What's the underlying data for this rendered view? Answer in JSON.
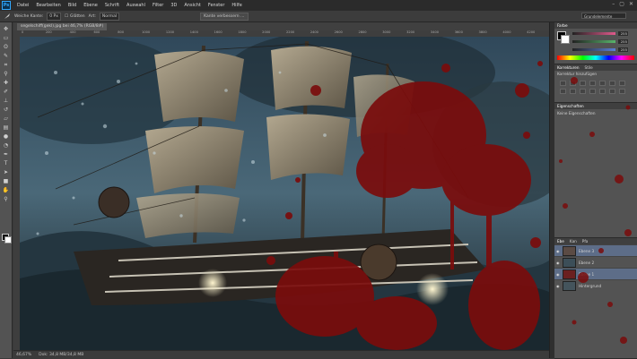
{
  "app": {
    "logo": "Ps",
    "menu": [
      "Datei",
      "Bearbeiten",
      "Bild",
      "Ebene",
      "Schrift",
      "Auswahl",
      "Filter",
      "3D",
      "Ansicht",
      "Fenster",
      "Hilfe"
    ],
    "window_controls": [
      "–",
      "▢",
      "✕"
    ]
  },
  "options_bar": {
    "tool_icon": "brush-icon",
    "size_label": "Weiche Kante:",
    "size_value": "0 Px",
    "smooth_label": "Glätten",
    "style_label": "Art:",
    "style_value": "Normal",
    "refine_button": "Kante verbessern …",
    "workspace": "Grundelemente"
  },
  "document": {
    "tab_title": "segelschiff(gekl).jpg bei 46,7% (RGB/8#)",
    "ruler_marks": [
      "0",
      "200",
      "400",
      "600",
      "800",
      "1000",
      "1200",
      "1400",
      "1600",
      "1800",
      "2000",
      "2200",
      "2400",
      "2600",
      "2800",
      "3000",
      "3200",
      "3400",
      "3600",
      "3800",
      "4000",
      "4200"
    ]
  },
  "status": {
    "zoom": "46,67%",
    "doc_size": "Dok: 34,8 MB/34,8 MB"
  },
  "panels": {
    "color": {
      "title": "Farbe",
      "sliders": [
        {
          "value": "255",
          "color": "#e05a8c"
        },
        {
          "value": "255",
          "color": "#58b36a"
        },
        {
          "value": "255",
          "color": "#5a7fd6"
        }
      ]
    },
    "adjustments": {
      "tabs": [
        "Korrekturen",
        "Stile"
      ],
      "title": "Korrektur hinzufügen"
    },
    "properties": {
      "tabs": [
        "Eigenschaften"
      ],
      "subtitle": "Keine Eigenschaften"
    },
    "layers": {
      "tabs": [
        "Ebe",
        "Kan",
        "Pfa"
      ],
      "rows": [
        {
          "name": "Ebene 3",
          "selected": true
        },
        {
          "name": "Ebene 2",
          "selected": false
        },
        {
          "name": "Ebene 1",
          "selected": true
        },
        {
          "name": "Hintergrund",
          "selected": false
        }
      ]
    }
  },
  "colors": {
    "accent": "#31a8ff",
    "blood": "#7a0c0c",
    "selection": "#5d6d88"
  }
}
